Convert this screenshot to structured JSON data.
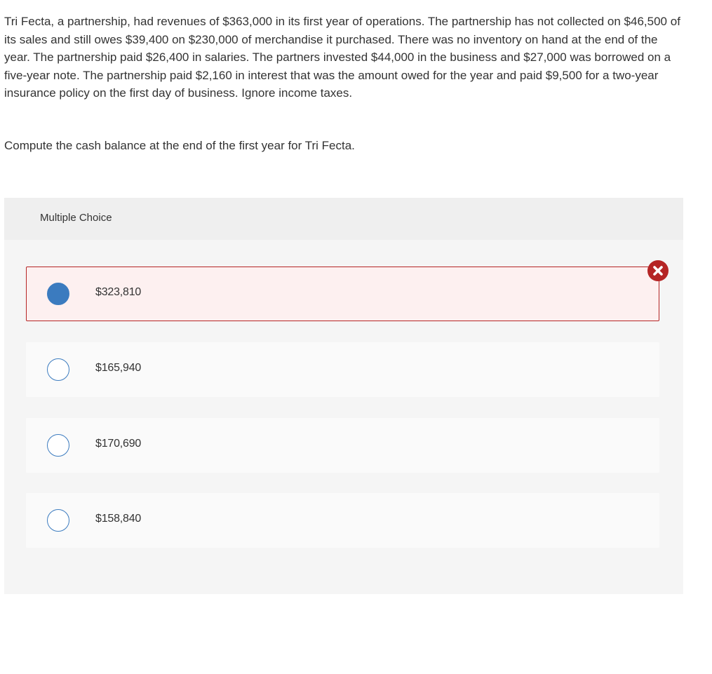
{
  "question": {
    "text": "Tri Fecta, a partnership, had revenues of $363,000 in its first year of operations. The partnership has not collected on $46,500 of its sales and still owes $39,400 on $230,000 of merchandise it purchased. There was no inventory on hand at the end of the year. The partnership paid $26,400 in salaries. The partners invested $44,000 in the business and $27,000 was borrowed on a five-year note. The partnership paid $2,160 in interest that was the amount owed for the year and paid $9,500 for a two-year insurance policy on the first day of business. Ignore income taxes.",
    "prompt": "Compute the cash balance at the end of the first year for Tri Fecta."
  },
  "multiple_choice": {
    "title": "Multiple Choice",
    "choices": [
      {
        "label": "$323,810",
        "selected": true,
        "status": "incorrect"
      },
      {
        "label": "$165,940",
        "selected": false
      },
      {
        "label": "$170,690",
        "selected": false
      },
      {
        "label": "$158,840",
        "selected": false
      }
    ],
    "feedback_icon": "x-circle-icon"
  },
  "colors": {
    "radio_blue": "#3b7bbf",
    "wrong_red": "#b52525",
    "wrong_bg": "#fdf0f0",
    "panel_bg": "#f5f5f5"
  }
}
